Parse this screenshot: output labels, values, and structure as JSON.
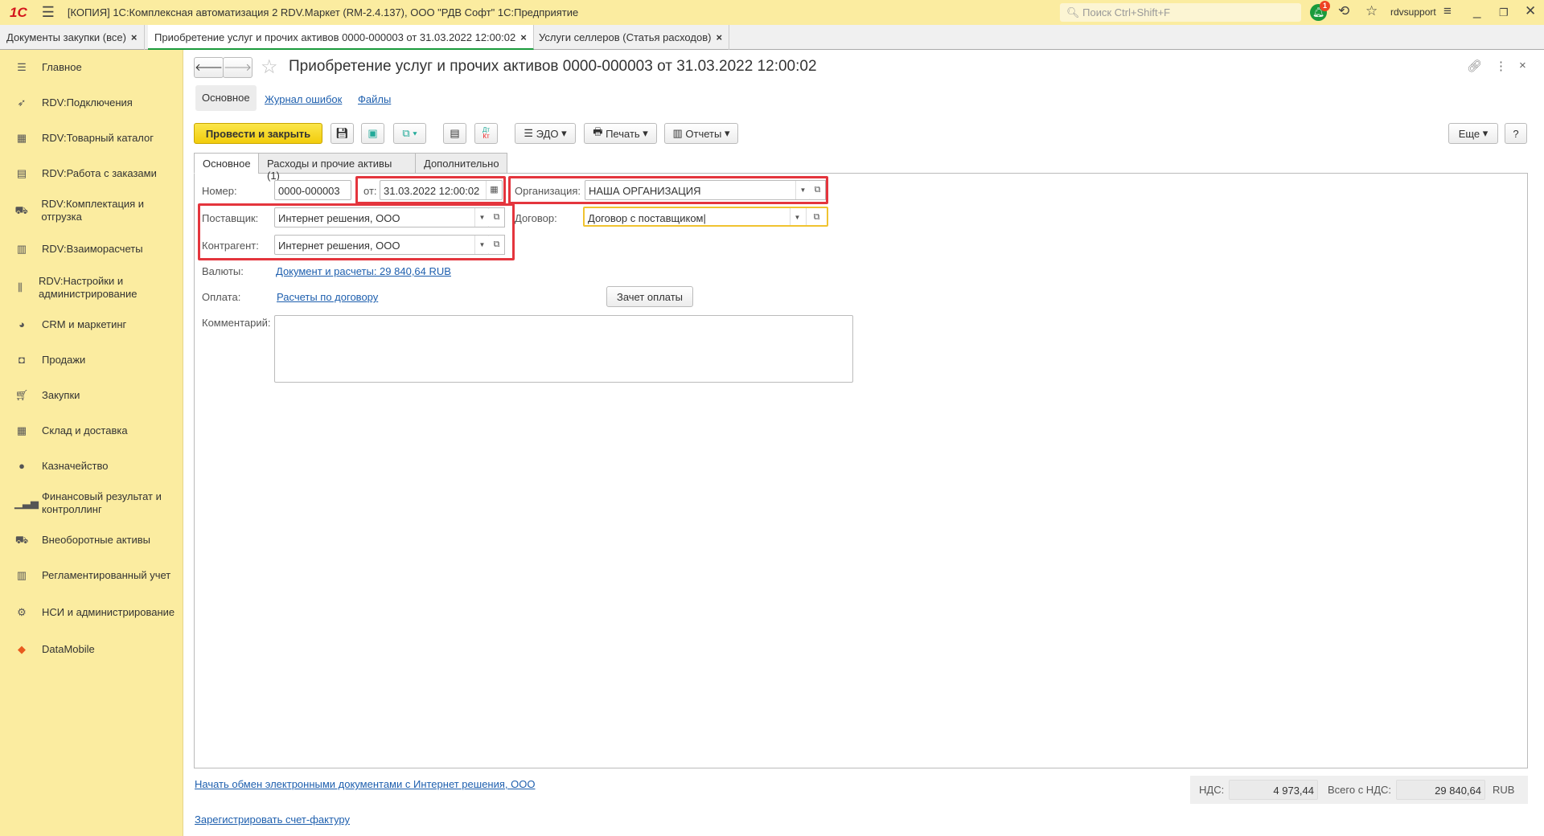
{
  "app": {
    "logo": "1С",
    "title": "[КОПИЯ] 1С:Комплексная автоматизация 2 RDV.Маркет (RM-2.4.137), ООО \"РДВ Софт\" 1С:Предприятие",
    "search_placeholder": "Поиск Ctrl+Shift+F",
    "notifications": "1",
    "user": "rdvsupport"
  },
  "open_tabs": [
    {
      "label": "Документы закупки (все)"
    },
    {
      "label": "Приобретение услуг и прочих активов 0000-000003 от 31.03.2022 12:00:02"
    },
    {
      "label": "Услуги селлеров (Статья расходов)"
    }
  ],
  "sidebar": {
    "items": [
      {
        "label": "Главное"
      },
      {
        "label": "RDV:Подключения"
      },
      {
        "label": "RDV:Товарный каталог"
      },
      {
        "label": "RDV:Работа с заказами"
      },
      {
        "label": "RDV:Комплектация и отгрузка"
      },
      {
        "label": "RDV:Взаиморасчеты"
      },
      {
        "label": "RDV:Настройки и администрирование"
      },
      {
        "label": "CRM и маркетинг"
      },
      {
        "label": "Продажи"
      },
      {
        "label": "Закупки"
      },
      {
        "label": "Склад и доставка"
      },
      {
        "label": "Казначейство"
      },
      {
        "label": "Финансовый результат и контроллинг"
      },
      {
        "label": "Внеоборотные активы"
      },
      {
        "label": "Регламентированный учет"
      },
      {
        "label": "НСИ и администрирование"
      },
      {
        "label": "DataMobile"
      }
    ]
  },
  "doc": {
    "title": "Приобретение услуг и прочих активов 0000-000003 от 31.03.2022 12:00:02",
    "subnav": [
      "Основное",
      "Журнал ошибок",
      "Файлы"
    ],
    "toolbar": {
      "post_close": "Провести и закрыть",
      "edo": "ЭДО",
      "print": "Печать",
      "reports": "Отчеты",
      "more": "Еще",
      "help": "?",
      "dtkt_top": "Дт",
      "dtkt_bottom": "Кт"
    },
    "tabs": [
      "Основное",
      "Расходы и прочие активы (1)",
      "Дополнительно"
    ],
    "fields": {
      "number_label": "Номер:",
      "number": "0000-000003",
      "date_label": "от:",
      "date": "31.03.2022 12:00:02",
      "org_label": "Организация:",
      "org": "НАША ОРГАНИЗАЦИЯ",
      "supplier_label": "Поставщик:",
      "supplier": "Интернет решения, ООО",
      "contract_label": "Договор:",
      "contract": "Договор с поставщиком",
      "counterparty_label": "Контрагент:",
      "counterparty": "Интернет решения, ООО",
      "currency_label": "Валюты:",
      "currency_link": "Документ и расчеты: 29 840,64 RUB",
      "payment_label": "Оплата:",
      "payment_link": "Расчеты по договору",
      "offset_button": "Зачет оплаты",
      "comment_label": "Комментарий:",
      "comment": ""
    },
    "footer": {
      "edo_link": "Начать обмен электронными документами с Интернет решения, ООО",
      "invoice_link": "Зарегистрировать счет-фактуру",
      "vat_label": "НДС:",
      "vat": "4 973,44",
      "total_label": "Всего с НДС:",
      "total": "29 840,64",
      "currency": "RUB"
    }
  }
}
